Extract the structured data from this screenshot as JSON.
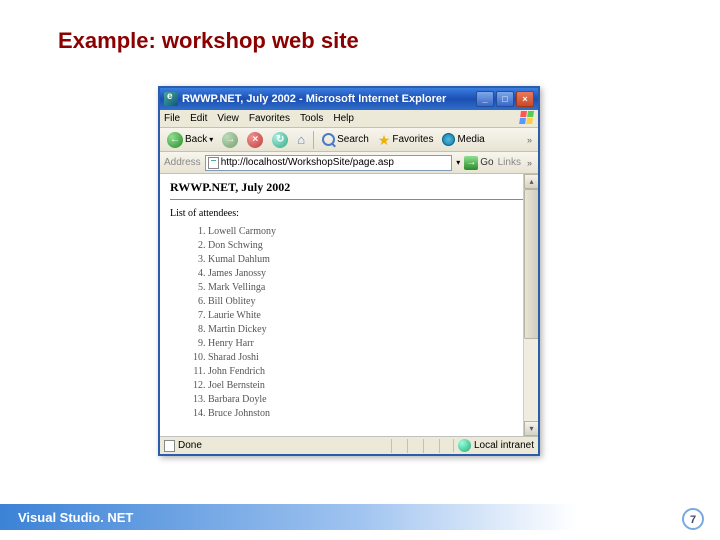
{
  "slide": {
    "title": "Example:  workshop web site"
  },
  "browser": {
    "title": "RWWP.NET, July 2002 - Microsoft Internet Explorer",
    "menus": [
      "File",
      "Edit",
      "View",
      "Favorites",
      "Tools",
      "Help"
    ],
    "toolbar": {
      "back": "Back",
      "search": "Search",
      "favorites": "Favorites",
      "media": "Media"
    },
    "address": {
      "label": "Address",
      "url": "http://localhost/WorkshopSite/page.asp",
      "go": "Go",
      "links": "Links"
    },
    "page": {
      "heading": "RWWP.NET, July 2002",
      "list_label": "List of attendees:",
      "attendees": [
        "Lowell Carmony",
        "Don Schwing",
        "Kumal Dahlum",
        "James Janossy",
        "Mark Vellinga",
        "Bill Oblitey",
        "Laurie White",
        "Martin Dickey",
        "Henry Harr",
        "Sharad Joshi",
        "John Fendrich",
        "Joel Bernstein",
        "Barbara Doyle",
        "Bruce Johnston"
      ]
    },
    "status": {
      "done": "Done",
      "zone": "Local intranet"
    }
  },
  "footer": {
    "text": "Visual Studio. NET",
    "page": "7"
  }
}
